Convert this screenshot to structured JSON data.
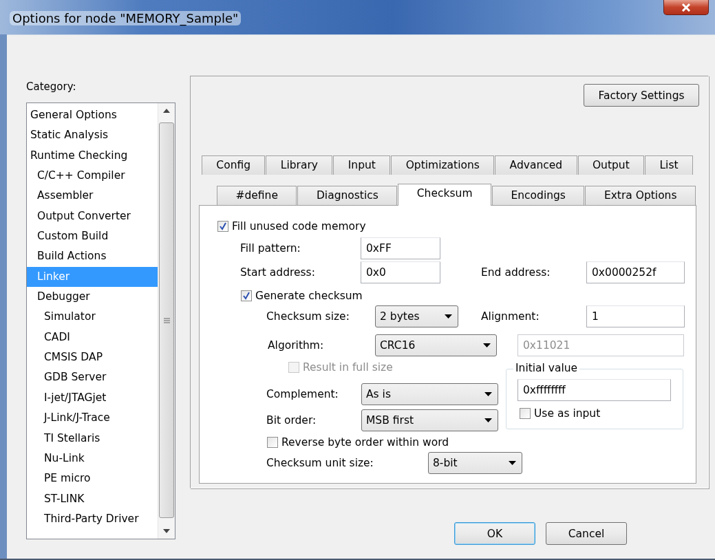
{
  "window": {
    "title": "Options for node \"MEMORY_Sample\""
  },
  "category": {
    "label": "Category:",
    "items": [
      {
        "label": "General Options",
        "selected": false
      },
      {
        "label": "Static Analysis",
        "selected": false
      },
      {
        "label": "Runtime Checking",
        "selected": false,
        "children": [
          {
            "label": "C/C++ Compiler",
            "selected": false
          },
          {
            "label": "Assembler",
            "selected": false
          },
          {
            "label": "Output Converter",
            "selected": false
          },
          {
            "label": "Custom Build",
            "selected": false
          },
          {
            "label": "Build Actions",
            "selected": false
          },
          {
            "label": "Linker",
            "selected": true
          },
          {
            "label": "Debugger",
            "selected": false,
            "children": [
              {
                "label": "Simulator",
                "selected": false
              },
              {
                "label": "CADI",
                "selected": false
              },
              {
                "label": "CMSIS DAP",
                "selected": false
              },
              {
                "label": "GDB Server",
                "selected": false
              },
              {
                "label": "I-jet/JTAGjet",
                "selected": false
              },
              {
                "label": "J-Link/J-Trace",
                "selected": false
              },
              {
                "label": "TI Stellaris",
                "selected": false
              },
              {
                "label": "Nu-Link",
                "selected": false
              },
              {
                "label": "PE micro",
                "selected": false
              },
              {
                "label": "ST-LINK",
                "selected": false
              },
              {
                "label": "Third-Party Driver",
                "selected": false
              }
            ]
          }
        ]
      }
    ]
  },
  "factory_settings": "Factory Settings",
  "tab_rows": [
    [
      {
        "label": "Config",
        "selected": false
      },
      {
        "label": "Library",
        "selected": false
      },
      {
        "label": "Input",
        "selected": false
      },
      {
        "label": "Optimizations",
        "selected": false
      },
      {
        "label": "Advanced",
        "selected": false
      },
      {
        "label": "Output",
        "selected": false
      },
      {
        "label": "List",
        "selected": false
      }
    ],
    [
      {
        "label": "#define",
        "selected": false
      },
      {
        "label": "Diagnostics",
        "selected": false
      },
      {
        "label": "Checksum",
        "selected": true
      },
      {
        "label": "Encodings",
        "selected": false
      },
      {
        "label": "Extra Options",
        "selected": false
      }
    ]
  ],
  "page": {
    "fill_unused": {
      "label": "Fill unused code memory",
      "checked": true
    },
    "fill_pattern": {
      "label": "Fill pattern:",
      "value": "0xFF"
    },
    "start_address": {
      "label": "Start address:",
      "value": "0x0"
    },
    "end_address": {
      "label": "End address:",
      "value": "0x0000252f"
    },
    "generate_checksum": {
      "label": "Generate checksum",
      "checked": true
    },
    "checksum_size": {
      "label": "Checksum size:",
      "value": "2 bytes"
    },
    "alignment": {
      "label": "Alignment:",
      "value": "1"
    },
    "algorithm": {
      "label": "Algorithm:",
      "value": "CRC16"
    },
    "polynomial": {
      "value": "0x11021",
      "disabled": true
    },
    "result_full_size": {
      "label": "Result in full size",
      "checked": false,
      "disabled": true
    },
    "complement": {
      "label": "Complement:",
      "value": "As is"
    },
    "bit_order": {
      "label": "Bit order:",
      "value": "MSB first"
    },
    "initial_value": {
      "title": "Initial value",
      "value": "0xffffffff"
    },
    "use_as_input": {
      "label": "Use as input",
      "checked": false
    },
    "reverse_byte_order": {
      "label": "Reverse byte order within word",
      "checked": false
    },
    "unit_size": {
      "label": "Checksum unit size:",
      "value": "8-bit"
    }
  },
  "buttons": [
    {
      "label": "OK",
      "default": true
    },
    {
      "label": "Cancel",
      "default": false
    }
  ]
}
